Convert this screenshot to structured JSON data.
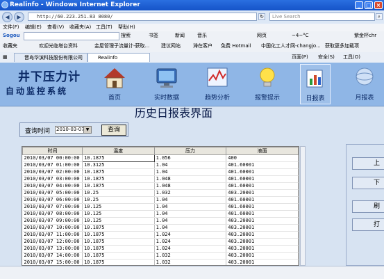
{
  "window": {
    "title": "Realinfo - Windows Internet Explorer"
  },
  "address": {
    "url": "http://60.223.251.83 8080/",
    "search_placeholder": "Live Search"
  },
  "menu": [
    "文件(F)",
    "编辑(E)",
    "查看(V)",
    "收藏夹(A)",
    "工具(T)",
    "帮助(H)"
  ],
  "toolbar1": {
    "logo": "Sogou",
    "search_label": "搜索",
    "items": [
      "书签",
      "新闻",
      "音乐",
      "网页",
      "~4~°C",
      "紫金杯chr"
    ]
  },
  "toolbar2": {
    "items": [
      "收藏夹",
      "欢迎光临塔台资料",
      "金屋管理子流量计-获取...",
      "建议网站",
      "滞在客户",
      "免费 Hotmail",
      "中国化工人才网-changjo...",
      "获取更多加载项"
    ]
  },
  "toolbar3": {
    "tabs": [
      "晋岛华滨科技股份有限公司",
      "Realinfo"
    ],
    "items": [
      "页面(P)",
      "安全(S)",
      "工具(O)"
    ]
  },
  "app": {
    "title_line1": "井下压力计",
    "title_line2": "自动监控系统",
    "nav": [
      {
        "label": "首页",
        "icon": "home-icon"
      },
      {
        "label": "实时数据",
        "icon": "monitor-icon"
      },
      {
        "label": "趋势分析",
        "icon": "trend-chart-icon"
      },
      {
        "label": "报警提示",
        "icon": "alarm-bulb-icon"
      },
      {
        "label": "日报表",
        "icon": "daily-report-icon"
      },
      {
        "label": "月报表",
        "icon": "monthly-report-icon"
      }
    ]
  },
  "page": {
    "title": "历史日报表界面",
    "query_label": "查询时间",
    "query_date": "2010-03-07",
    "query_button": "查询"
  },
  "grid": {
    "columns": [
      "时间",
      "温度",
      "压力",
      "液面"
    ],
    "rows": [
      [
        "2010/03/07 00:00:00",
        "10.1875",
        "1.056",
        "400"
      ],
      [
        "2010/03/07 01:00:00",
        "10.3125",
        "1.04",
        "401.60001"
      ],
      [
        "2010/03/07 02:00:00",
        "10.1875",
        "1.04",
        "401.60001"
      ],
      [
        "2010/03/07 03:00:00",
        "10.1875",
        "1.048",
        "401.60001"
      ],
      [
        "2010/03/07 04:00:00",
        "10.1875",
        "1.048",
        "401.60001"
      ],
      [
        "2010/03/07 05:00:00",
        "10.25",
        "1.032",
        "403.20001"
      ],
      [
        "2010/03/07 06:00:00",
        "10.25",
        "1.04",
        "401.60001"
      ],
      [
        "2010/03/07 07:00:00",
        "10.125",
        "1.04",
        "401.60001"
      ],
      [
        "2010/03/07 08:00:00",
        "10.125",
        "1.04",
        "401.60001"
      ],
      [
        "2010/03/07 09:00:00",
        "10.125",
        "1.04",
        "403.20001"
      ],
      [
        "2010/03/07 10:00:00",
        "10.1875",
        "1.04",
        "403.20001"
      ],
      [
        "2010/03/07 11:00:00",
        "10.1875",
        "1.024",
        "403.20001"
      ],
      [
        "2010/03/07 12:00:00",
        "10.1875",
        "1.024",
        "403.20001"
      ],
      [
        "2010/03/07 13:00:00",
        "10.1875",
        "1.024",
        "403.20001"
      ],
      [
        "2010/03/07 14:00:00",
        "10.1875",
        "1.032",
        "403.20001"
      ],
      [
        "2010/03/07 15:00:00",
        "10.1875",
        "1.032",
        "403.20001"
      ]
    ]
  },
  "side_buttons": [
    "上",
    "下",
    "刷",
    "打"
  ]
}
